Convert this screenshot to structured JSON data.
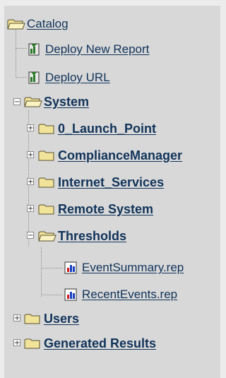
{
  "tree": {
    "root": {
      "label": "Catalog",
      "icon": "open-folder-icon"
    },
    "deploy_new_report": {
      "label": "Deploy New Report",
      "icon": "deploy-icon"
    },
    "deploy_url": {
      "label": "Deploy URL",
      "icon": "deploy-icon"
    },
    "system": {
      "label": "System",
      "expander": "−",
      "children": {
        "launch_point": {
          "label": "0_Launch_Point",
          "expander": "+"
        },
        "compliance_manager": {
          "label": "ComplianceManager",
          "expander": "+"
        },
        "internet_services": {
          "label": "Internet_Services",
          "expander": "+"
        },
        "remote_system": {
          "label": "Remote System",
          "expander": "+"
        },
        "thresholds": {
          "label": "Thresholds",
          "expander": "−",
          "reports": [
            {
              "label": "EventSummary.rep",
              "icon": "report-chart-icon"
            },
            {
              "label": "RecentEvents.rep",
              "icon": "report-chart-icon"
            }
          ]
        }
      }
    },
    "users": {
      "label": "Users",
      "expander": "+"
    },
    "generated_results": {
      "label": "Generated Results",
      "expander": "+"
    }
  },
  "colors": {
    "link": "#10335a",
    "panel": "#d8d8d8",
    "folder": "#f2e39a",
    "folder_edge": "#5a5230"
  }
}
